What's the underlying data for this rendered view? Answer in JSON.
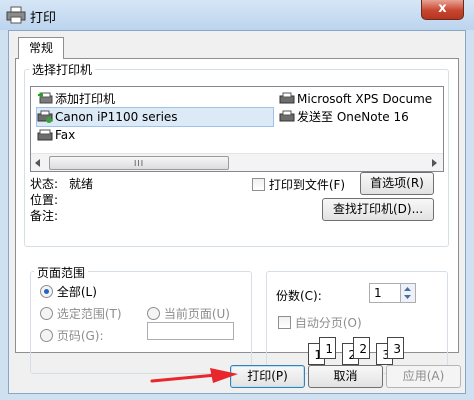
{
  "window": {
    "title": "打印",
    "close_symbol": "x"
  },
  "tabs": {
    "general": "常规"
  },
  "select_printer": {
    "group_title": "选择打印机",
    "printers_left": [
      {
        "name": "添加打印机",
        "icon": "add-printer-icon"
      },
      {
        "name": "Canon iP1100 series",
        "icon": "printer-icon",
        "selected": true
      },
      {
        "name": "Fax",
        "icon": "fax-icon"
      }
    ],
    "printers_right": [
      {
        "name": "Microsoft XPS Docume",
        "icon": "printer-icon"
      },
      {
        "name": "发送至 OneNote 16",
        "icon": "printer-icon"
      }
    ],
    "scroll_grip": "III",
    "status_label": "状态:",
    "status_value": "就绪",
    "location_label": "位置:",
    "comment_label": "备注:",
    "print_to_file": "打印到文件(F)",
    "preferences_button": "首选项(R)",
    "find_printer_button": "查找打印机(D)..."
  },
  "page_range": {
    "group_title": "页面范围",
    "all": "全部(L)",
    "selection": "选定范围(T)",
    "current_page": "当前页面(U)",
    "pages": "页码(G):"
  },
  "copies": {
    "label": "份数(C):",
    "value": "1",
    "collate": "自动分页(O)",
    "preview_pages": [
      "1",
      "1",
      "2",
      "2",
      "3",
      "3"
    ]
  },
  "footer": {
    "print_button": "打印(P)",
    "cancel_button": "取消",
    "apply_button": "应用(A)"
  },
  "colors": {
    "accent": "#2563c6",
    "arrow": "#e8262b"
  }
}
